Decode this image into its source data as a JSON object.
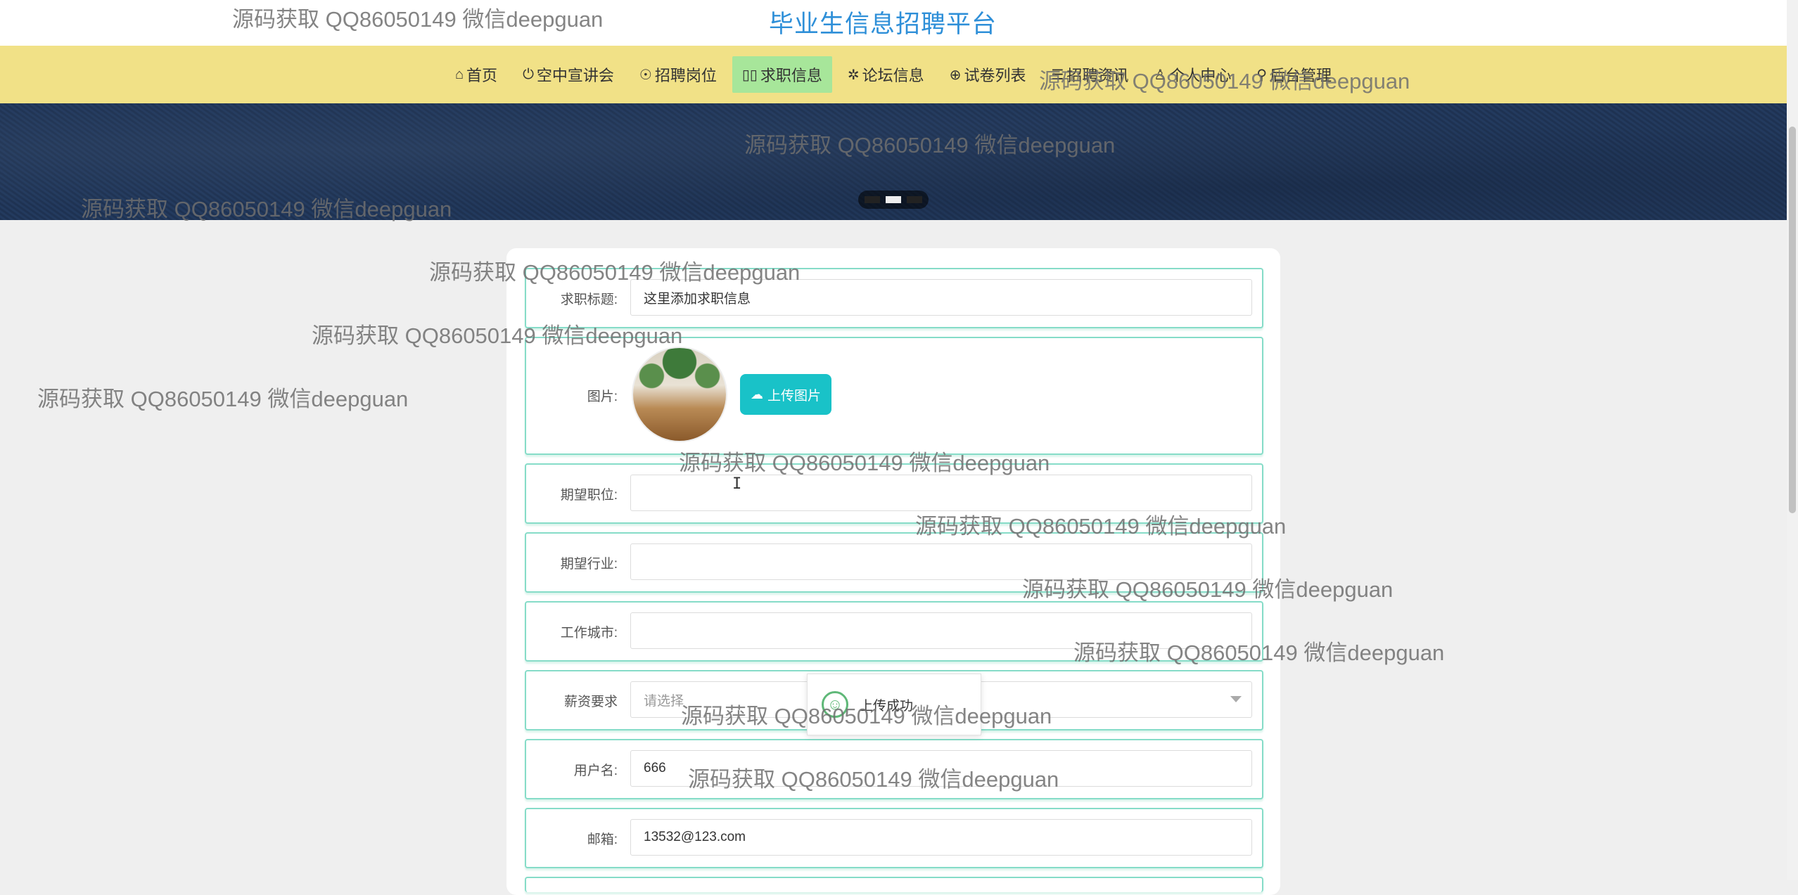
{
  "site": {
    "title": "毕业生信息招聘平台"
  },
  "nav": {
    "items": [
      {
        "icon": "⌂",
        "label": "首页"
      },
      {
        "icon": "⏻",
        "label": "空中宣讲会"
      },
      {
        "icon": "☉",
        "label": "招聘岗位"
      },
      {
        "icon": "▯▯",
        "label": "求职信息"
      },
      {
        "icon": "✲",
        "label": "论坛信息"
      },
      {
        "icon": "⊕",
        "label": "试卷列表"
      },
      {
        "icon": "☰",
        "label": "招聘资讯"
      },
      {
        "icon": "♙",
        "label": "个人中心"
      },
      {
        "icon": "⚲",
        "label": "后台管理"
      }
    ]
  },
  "form": {
    "title_label": "求职标题:",
    "title_value": "这里添加求职信息",
    "image_label": "图片:",
    "upload_label": "上传图片",
    "position_label": "期望职位:",
    "position_value": "",
    "industry_label": "期望行业:",
    "industry_value": "",
    "city_label": "工作城市:",
    "city_value": "",
    "salary_label": "薪资要求",
    "salary_placeholder": "请选择",
    "username_label": "用户名:",
    "username_value": "666",
    "email_label": "邮箱:",
    "email_value": "13532@123.com"
  },
  "toast": {
    "text": "上传成功"
  },
  "watermark": "源码获取 QQ86050149 微信deepguan"
}
